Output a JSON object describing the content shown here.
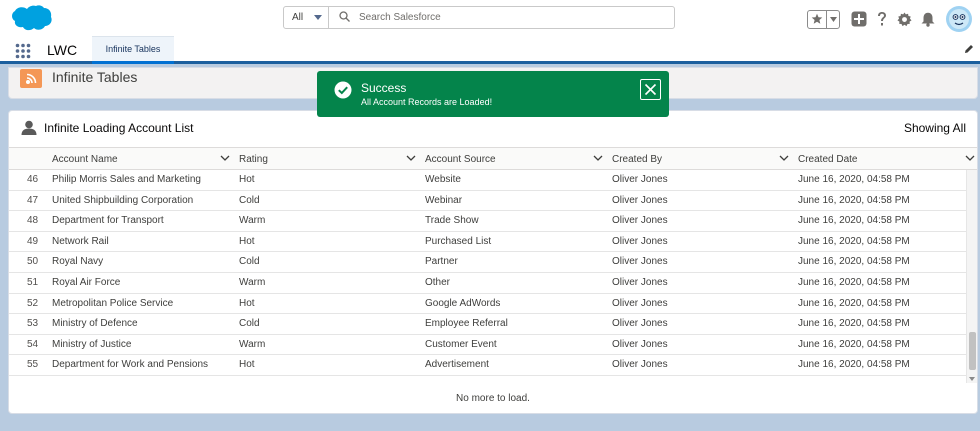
{
  "search": {
    "scope": "All",
    "placeholder": "Search Salesforce"
  },
  "nav": {
    "app_name": "LWC",
    "tab_label": "Infinite Tables"
  },
  "page_header": {
    "title": "Infinite Tables"
  },
  "toast": {
    "title": "Success",
    "message": "All Account Records are Loaded!"
  },
  "card": {
    "title": "Infinite Loading Account List",
    "status": "Showing All",
    "footer": "No more to load."
  },
  "table": {
    "columns": [
      "Account Name",
      "Rating",
      "Account Source",
      "Created By",
      "Created Date"
    ],
    "rows": [
      [
        "46",
        "Philip Morris Sales and Marketing",
        "Hot",
        "Website",
        "Oliver Jones",
        "June 16, 2020, 04:58 PM"
      ],
      [
        "47",
        "United Shipbuilding Corporation",
        "Cold",
        "Webinar",
        "Oliver Jones",
        "June 16, 2020, 04:58 PM"
      ],
      [
        "48",
        "Department for Transport",
        "Warm",
        "Trade Show",
        "Oliver Jones",
        "June 16, 2020, 04:58 PM"
      ],
      [
        "49",
        "Network Rail",
        "Hot",
        "Purchased List",
        "Oliver Jones",
        "June 16, 2020, 04:58 PM"
      ],
      [
        "50",
        "Royal Navy",
        "Cold",
        "Partner",
        "Oliver Jones",
        "June 16, 2020, 04:58 PM"
      ],
      [
        "51",
        "Royal Air Force",
        "Warm",
        "Other",
        "Oliver Jones",
        "June 16, 2020, 04:58 PM"
      ],
      [
        "52",
        "Metropolitan Police Service",
        "Hot",
        "Google AdWords",
        "Oliver Jones",
        "June 16, 2020, 04:58 PM"
      ],
      [
        "53",
        "Ministry of Defence",
        "Cold",
        "Employee Referral",
        "Oliver Jones",
        "June 16, 2020, 04:58 PM"
      ],
      [
        "54",
        "Ministry of Justice",
        "Warm",
        "Customer Event",
        "Oliver Jones",
        "June 16, 2020, 04:58 PM"
      ],
      [
        "55",
        "Department for Work and Pensions",
        "Hot",
        "Advertisement",
        "Oliver Jones",
        "June 16, 2020, 04:58 PM"
      ]
    ]
  },
  "colors": {
    "brand": "#0070d2",
    "success": "#04844b",
    "nav_accent": "#1b5f9e",
    "page_icon": "#f49756"
  },
  "icons": [
    "salesforce-cloud-icon",
    "search-icon",
    "star-icon",
    "plus-icon",
    "help-icon",
    "gear-icon",
    "bell-icon",
    "avatar-icon",
    "app-launcher-icon",
    "pencil-icon",
    "page-header-icon",
    "user-icon",
    "check-circle-icon",
    "close-icon",
    "chevron-down-icon"
  ]
}
